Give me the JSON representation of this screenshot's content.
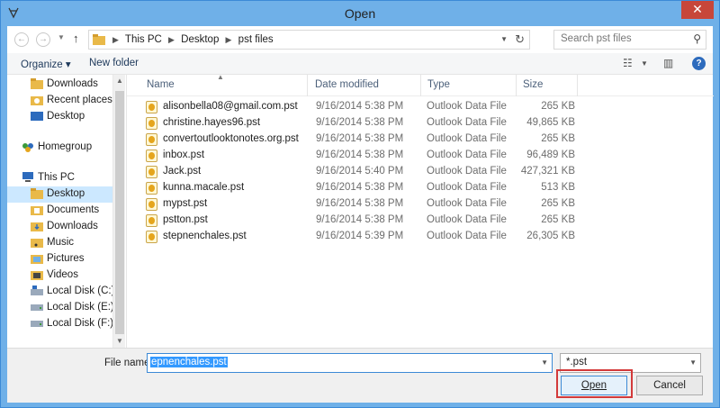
{
  "window": {
    "title": "Open",
    "close_glyph": "✕"
  },
  "address": {
    "crumbs": [
      "This PC",
      "Desktop",
      "pst files"
    ],
    "search_placeholder": "Search pst files"
  },
  "toolbar": {
    "organize": "Organize ▾",
    "new_folder": "New folder"
  },
  "nav": {
    "items": [
      {
        "label": "Downloads",
        "icon": "downloads-folder-icon",
        "color": "#d8a13c"
      },
      {
        "label": "Recent places",
        "icon": "recent-places-icon",
        "color": "#d8a13c"
      },
      {
        "label": "Desktop",
        "icon": "desktop-icon",
        "color": "#2d6bbd"
      },
      {
        "label": "Homegroup",
        "icon": "homegroup-icon",
        "color": "#3b9a3b"
      },
      {
        "label": "This PC",
        "icon": "this-pc-icon",
        "color": "#2d6bbd"
      },
      {
        "label": "Desktop",
        "icon": "desktop-icon",
        "color": "#2d6bbd",
        "selected": true
      },
      {
        "label": "Documents",
        "icon": "documents-folder-icon",
        "color": "#d8a13c"
      },
      {
        "label": "Downloads",
        "icon": "downloads-folder-icon",
        "color": "#d8a13c"
      },
      {
        "label": "Music",
        "icon": "music-folder-icon",
        "color": "#d8a13c"
      },
      {
        "label": "Pictures",
        "icon": "pictures-folder-icon",
        "color": "#d8a13c"
      },
      {
        "label": "Videos",
        "icon": "videos-folder-icon",
        "color": "#d8a13c"
      },
      {
        "label": "Local Disk (C:)",
        "icon": "drive-c-icon",
        "color": "#7a8fa8"
      },
      {
        "label": "Local Disk (E:)",
        "icon": "drive-icon",
        "color": "#7a8fa8"
      },
      {
        "label": "Local Disk (F:)",
        "icon": "drive-icon",
        "color": "#7a8fa8"
      }
    ]
  },
  "columns": {
    "name": "Name",
    "date": "Date modified",
    "type": "Type",
    "size": "Size"
  },
  "files": [
    {
      "name": "alisonbella08@gmail.com.pst",
      "date": "9/16/2014 5:38 PM",
      "type": "Outlook Data File",
      "size": "265 KB"
    },
    {
      "name": "christine.hayes96.pst",
      "date": "9/16/2014 5:38 PM",
      "type": "Outlook Data File",
      "size": "49,865 KB"
    },
    {
      "name": "convertoutlooktonotes.org.pst",
      "date": "9/16/2014 5:38 PM",
      "type": "Outlook Data File",
      "size": "265 KB"
    },
    {
      "name": "inbox.pst",
      "date": "9/16/2014 5:38 PM",
      "type": "Outlook Data File",
      "size": "96,489 KB"
    },
    {
      "name": "Jack.pst",
      "date": "9/16/2014 5:40 PM",
      "type": "Outlook Data File",
      "size": "427,321 KB"
    },
    {
      "name": "kunna.macale.pst",
      "date": "9/16/2014 5:38 PM",
      "type": "Outlook Data File",
      "size": "513 KB"
    },
    {
      "name": "mypst.pst",
      "date": "9/16/2014 5:38 PM",
      "type": "Outlook Data File",
      "size": "265 KB"
    },
    {
      "name": "pstton.pst",
      "date": "9/16/2014 5:38 PM",
      "type": "Outlook Data File",
      "size": "265 KB"
    },
    {
      "name": "stepnenchales.pst",
      "date": "9/16/2014 5:39 PM",
      "type": "Outlook Data File",
      "size": "26,305 KB"
    }
  ],
  "footer": {
    "file_name_label": "File name:",
    "file_name_value": "epnenchales.pst",
    "filter": "*.pst",
    "open": "Open",
    "cancel": "Cancel",
    "highlight_color": "#d33a3a"
  }
}
